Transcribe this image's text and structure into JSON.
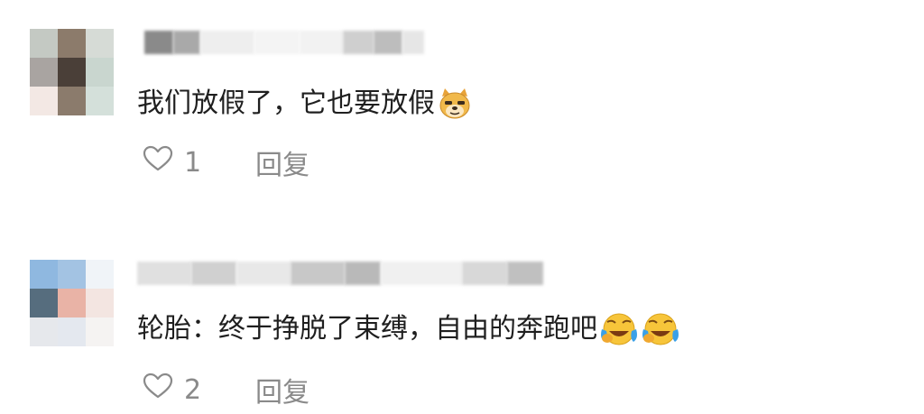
{
  "comments": [
    {
      "text": "我们放假了，它也要放假",
      "emoji": "doge-emoji",
      "likes": "1",
      "reply_label": "回复",
      "avatar_colors": [
        "#c4c9c3",
        "#8c7b6b",
        "#d6dbd6",
        "#a9a4a1",
        "#4a3f38",
        "#c9d6cf",
        "#f3e8e4",
        "#8b7b6c",
        "#d4e0da"
      ],
      "name_colors": [
        "#8a8a8a",
        "#a9a9a9",
        "#eeeeee",
        "#f4f4f4",
        "#f2f2f2",
        "#cfcfcf",
        "#bdbdbd",
        "#e6e6e6"
      ]
    },
    {
      "text": "轮胎：终于挣脱了束缚，自由的奔跑吧",
      "emoji": "laugh-cry-emoji",
      "likes": "2",
      "reply_label": "回复",
      "avatar_colors": [
        "#8fb8e0",
        "#a3c3e3",
        "#f0f4f8",
        "#566d7e",
        "#e9b3a6",
        "#f3e5e1",
        "#e6e8ec",
        "#e4e8ef",
        "#f5f3f2"
      ],
      "name_colors": [
        "#e0e0e0",
        "#d0d0d0",
        "#e8e8e8",
        "#c8c8c8",
        "#b9b9b9",
        "#f0f0f0",
        "#d8d8d8",
        "#c0c0c0"
      ]
    }
  ]
}
